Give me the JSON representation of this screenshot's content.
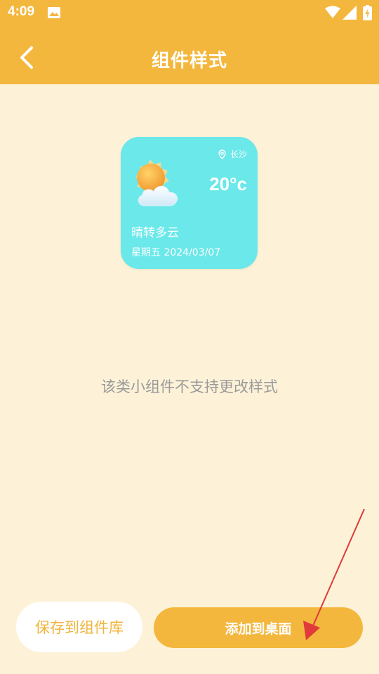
{
  "status_bar": {
    "time": "4:09",
    "icons": [
      "photo-icon",
      "wifi-icon",
      "signal-icon",
      "battery-charging-icon"
    ]
  },
  "header": {
    "title": "组件样式",
    "back_icon": "chevron-left-icon",
    "background": "#f4b73d"
  },
  "widget": {
    "location": "长沙",
    "location_icon": "location-pin-icon",
    "temperature": "20°c",
    "condition": "晴转多云",
    "date": "星期五 2024/03/07",
    "weather_icon": "sun-cloud-icon",
    "background": "#6ae8ea"
  },
  "message": "该类小组件不支持更改样式",
  "buttons": {
    "save_label": "保存到组件库",
    "add_label": "添加到桌面"
  },
  "colors": {
    "accent": "#f4b73d",
    "page_background": "#fdf2d8",
    "annotation_arrow": "#e03a3a"
  }
}
